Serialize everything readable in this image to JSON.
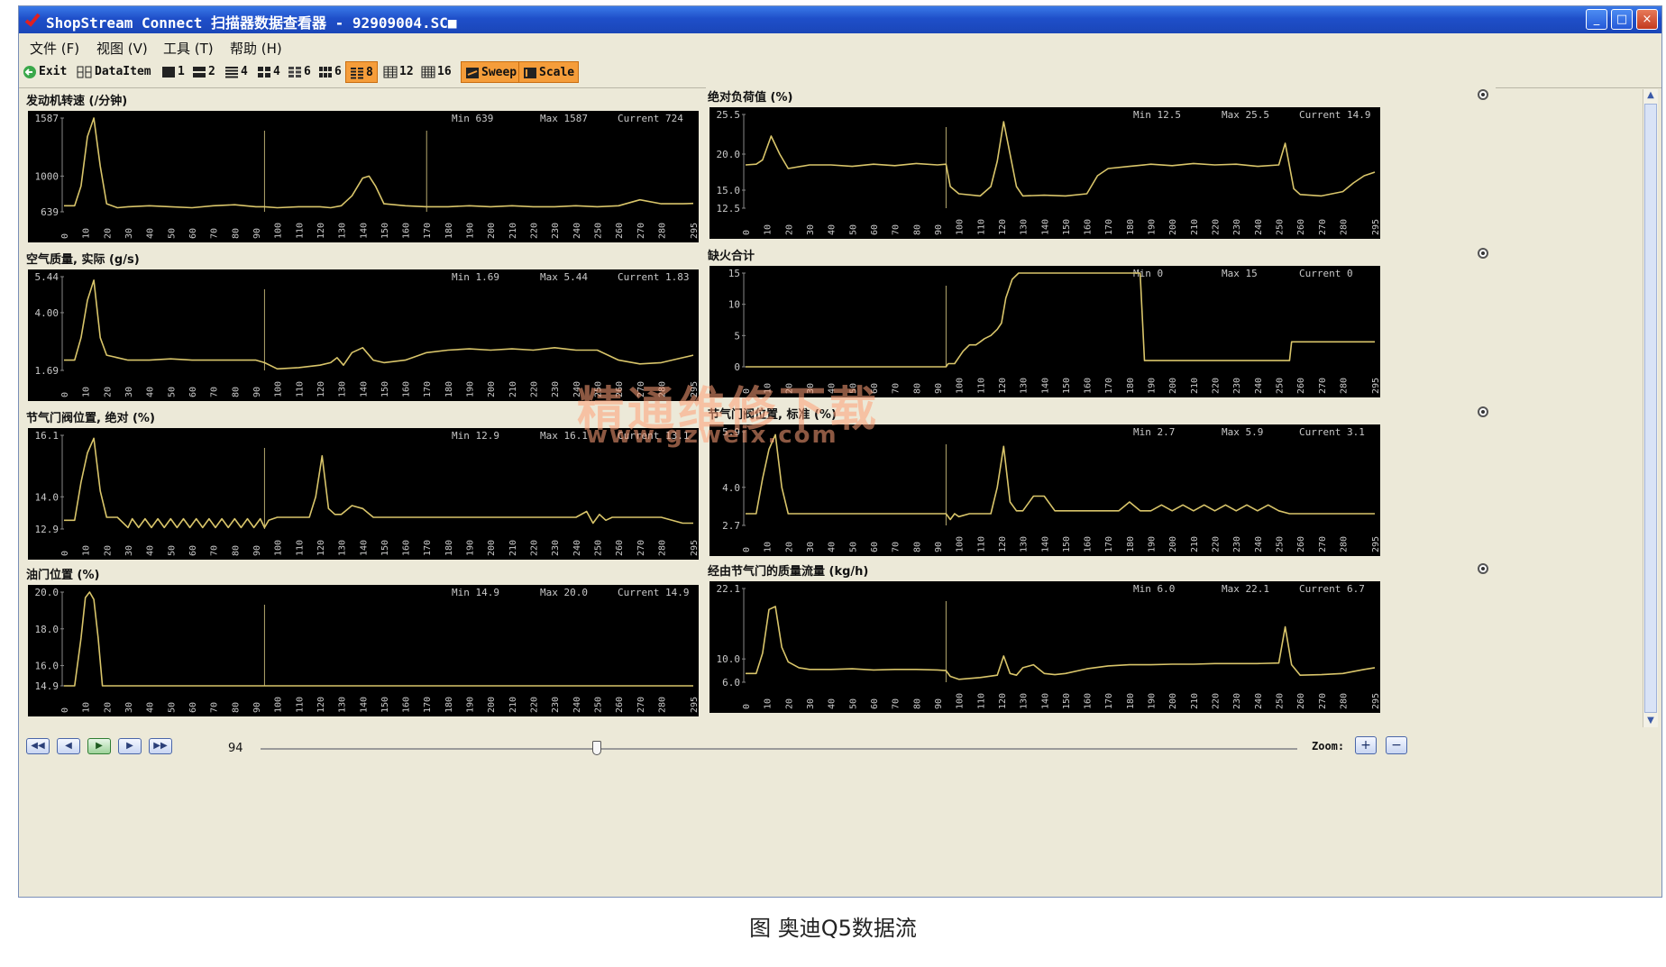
{
  "window": {
    "title": "ShopStream Connect 扫描器数据查看器 - 92909004.SC■",
    "controls": {
      "minimize": "_",
      "maximize": "□",
      "close": "×"
    }
  },
  "menu": [
    {
      "label": "文件 (F)"
    },
    {
      "label": "视图 (V)"
    },
    {
      "label": "工具 (T)"
    },
    {
      "label": "帮助 (H)"
    }
  ],
  "toolbar": {
    "exit": "Exit",
    "dataitem": "DataItem",
    "layouts": [
      "1",
      "2",
      "4",
      "4",
      "6",
      "6",
      "8",
      "12",
      "16"
    ],
    "active_layout_index": 6,
    "sweep": "Sweep",
    "scale": "Scale"
  },
  "chart_data": [
    {
      "type": "line",
      "title": "发动机转速 (/分钟)",
      "min_label": "Min",
      "max_label": "Max",
      "current_label": "Current",
      "min": "639",
      "max": "1587",
      "current": "724",
      "y_ticks": [
        "1587",
        "1000",
        "639"
      ],
      "y_tick_values": [
        1587,
        1000,
        639
      ],
      "ylim": [
        639,
        1587
      ],
      "x_ticks": [
        "0",
        "10",
        "20",
        "30",
        "40",
        "50",
        "60",
        "70",
        "80",
        "90",
        "100",
        "110",
        "120",
        "130",
        "140",
        "150",
        "160",
        "170",
        "180",
        "190",
        "200",
        "210",
        "220",
        "230",
        "240",
        "250",
        "260",
        "270",
        "280",
        "295"
      ],
      "xlim": [
        0,
        295
      ],
      "markers": [
        94,
        170
      ],
      "x": [
        0,
        5,
        8,
        11,
        14,
        17,
        20,
        25,
        30,
        40,
        50,
        60,
        70,
        80,
        90,
        94,
        100,
        110,
        120,
        125,
        130,
        135,
        140,
        143,
        146,
        150,
        160,
        170,
        180,
        190,
        200,
        210,
        220,
        230,
        240,
        250,
        260,
        270,
        280,
        290,
        295
      ],
      "y": [
        700,
        700,
        900,
        1400,
        1587,
        1100,
        720,
        680,
        690,
        700,
        690,
        680,
        700,
        710,
        690,
        690,
        680,
        690,
        690,
        680,
        700,
        800,
        980,
        1000,
        900,
        720,
        700,
        690,
        690,
        700,
        690,
        700,
        690,
        690,
        700,
        690,
        700,
        760,
        720,
        720,
        724
      ]
    },
    {
      "type": "line",
      "title": "绝对负荷值 (%)",
      "min_label": "Min",
      "max_label": "Max",
      "current_label": "Current",
      "min": "12.5",
      "max": "25.5",
      "current": "14.9",
      "y_ticks": [
        "25.5",
        "20.0",
        "15.0",
        "12.5"
      ],
      "y_tick_values": [
        25.5,
        20.0,
        15.0,
        12.5
      ],
      "ylim": [
        12.5,
        25.5
      ],
      "x_ticks": [
        "0",
        "10",
        "20",
        "30",
        "40",
        "50",
        "60",
        "70",
        "80",
        "90",
        "100",
        "110",
        "120",
        "130",
        "140",
        "150",
        "160",
        "170",
        "180",
        "190",
        "200",
        "210",
        "220",
        "230",
        "240",
        "250",
        "260",
        "270",
        "280",
        "295"
      ],
      "xlim": [
        0,
        295
      ],
      "markers": [
        94
      ],
      "x": [
        0,
        5,
        8,
        12,
        16,
        20,
        30,
        40,
        50,
        60,
        70,
        80,
        90,
        94,
        96,
        100,
        110,
        115,
        118,
        121,
        124,
        127,
        130,
        140,
        150,
        160,
        165,
        170,
        180,
        190,
        200,
        210,
        220,
        230,
        240,
        250,
        253,
        257,
        260,
        270,
        280,
        285,
        290,
        295
      ],
      "y": [
        18.5,
        18.6,
        19.2,
        22.5,
        20,
        18,
        18.5,
        18.5,
        18.3,
        18.6,
        18.4,
        18.7,
        18.5,
        18.6,
        15.5,
        14.5,
        14.2,
        15.5,
        19,
        24.5,
        20,
        15.5,
        14.2,
        14.3,
        14.2,
        14.5,
        17,
        18,
        18.3,
        18.6,
        18.4,
        18.7,
        18.5,
        18.6,
        18.3,
        18.5,
        21.5,
        15.2,
        14.4,
        14.2,
        14.8,
        16,
        17,
        17.5
      ]
    },
    {
      "type": "line",
      "title": "空气质量, 实际 (g/s)",
      "min_label": "Min",
      "max_label": "Max",
      "current_label": "Current",
      "min": "1.69",
      "max": "5.44",
      "current": "1.83",
      "y_ticks": [
        "5.44",
        "4.00",
        "1.69"
      ],
      "y_tick_values": [
        5.44,
        4.0,
        1.69
      ],
      "ylim": [
        1.69,
        5.44
      ],
      "x_ticks": [
        "0",
        "10",
        "20",
        "30",
        "40",
        "50",
        "60",
        "70",
        "80",
        "90",
        "100",
        "110",
        "120",
        "130",
        "140",
        "150",
        "160",
        "170",
        "180",
        "190",
        "200",
        "210",
        "220",
        "230",
        "240",
        "250",
        "260",
        "270",
        "280",
        "295"
      ],
      "xlim": [
        0,
        295
      ],
      "markers": [
        94
      ],
      "x": [
        0,
        5,
        8,
        11,
        14,
        17,
        20,
        30,
        40,
        50,
        60,
        70,
        80,
        90,
        94,
        100,
        110,
        120,
        125,
        128,
        131,
        135,
        140,
        145,
        150,
        160,
        170,
        180,
        190,
        200,
        210,
        220,
        230,
        240,
        250,
        260,
        270,
        280,
        290,
        295
      ],
      "y": [
        2.1,
        2.1,
        3,
        4.5,
        5.3,
        3,
        2.3,
        2.1,
        2.1,
        2.15,
        2.1,
        2.1,
        2.1,
        2.1,
        2.0,
        1.75,
        1.8,
        1.9,
        2.0,
        2.2,
        1.9,
        2.4,
        2.6,
        2.1,
        2.0,
        2.1,
        2.4,
        2.5,
        2.55,
        2.5,
        2.55,
        2.5,
        2.6,
        2.5,
        2.5,
        2.1,
        1.95,
        2.0,
        2.2,
        2.3
      ]
    },
    {
      "type": "line",
      "title": "缺火合计",
      "min_label": "Min",
      "max_label": "Max",
      "current_label": "Current",
      "min": "0",
      "max": "15",
      "current": "0",
      "y_ticks": [
        "15",
        "10",
        "5",
        "0"
      ],
      "y_tick_values": [
        15,
        10,
        5,
        0
      ],
      "ylim": [
        0,
        15
      ],
      "x_ticks": [
        "0",
        "10",
        "20",
        "30",
        "40",
        "50",
        "60",
        "70",
        "80",
        "90",
        "100",
        "110",
        "120",
        "130",
        "140",
        "150",
        "160",
        "170",
        "180",
        "190",
        "200",
        "210",
        "220",
        "230",
        "240",
        "250",
        "260",
        "270",
        "280",
        "295"
      ],
      "xlim": [
        0,
        295
      ],
      "markers": [
        94
      ],
      "x": [
        0,
        94,
        95,
        98,
        100,
        102,
        105,
        108,
        110,
        112,
        115,
        118,
        120,
        122,
        125,
        128,
        130,
        185,
        186,
        187,
        190,
        200,
        250,
        255,
        256,
        260,
        280,
        295
      ],
      "y": [
        0,
        0,
        0.5,
        0.5,
        1.5,
        2.5,
        3.5,
        3.5,
        4,
        4.5,
        5,
        6,
        7,
        11,
        14,
        15,
        15,
        15,
        8,
        1,
        1,
        1,
        1,
        1,
        4,
        4,
        4,
        4
      ]
    },
    {
      "type": "line",
      "title": "节气门阀位置, 绝对 (%)",
      "min_label": "Min",
      "max_label": "Max",
      "current_label": "Current",
      "min": "12.9",
      "max": "16.1",
      "current": "13.1",
      "y_ticks": [
        "16.1",
        "14.0",
        "12.9"
      ],
      "y_tick_values": [
        16.1,
        14.0,
        12.9
      ],
      "ylim": [
        12.9,
        16.1
      ],
      "x_ticks": [
        "0",
        "10",
        "20",
        "30",
        "40",
        "50",
        "60",
        "70",
        "80",
        "90",
        "100",
        "110",
        "120",
        "130",
        "140",
        "150",
        "160",
        "170",
        "180",
        "190",
        "200",
        "210",
        "220",
        "230",
        "240",
        "250",
        "260",
        "270",
        "280",
        "295"
      ],
      "xlim": [
        0,
        295
      ],
      "markers": [
        94
      ],
      "x": [
        0,
        5,
        8,
        11,
        14,
        17,
        20,
        25,
        30,
        32,
        35,
        38,
        41,
        44,
        47,
        50,
        53,
        56,
        59,
        62,
        65,
        68,
        71,
        74,
        77,
        80,
        83,
        86,
        89,
        92,
        94,
        96,
        100,
        110,
        115,
        118,
        121,
        124,
        127,
        130,
        135,
        140,
        145,
        150,
        160,
        170,
        180,
        190,
        200,
        210,
        220,
        230,
        240,
        245,
        248,
        251,
        254,
        257,
        260,
        270,
        280,
        290,
        295
      ],
      "y": [
        13.2,
        13.2,
        14.5,
        15.5,
        16.0,
        14.2,
        13.3,
        13.3,
        12.95,
        13.25,
        12.95,
        13.25,
        12.95,
        13.25,
        12.95,
        13.25,
        12.95,
        13.25,
        12.95,
        13.25,
        12.95,
        13.25,
        12.95,
        13.25,
        12.95,
        13.25,
        12.95,
        13.25,
        12.95,
        13.25,
        12.95,
        13.2,
        13.3,
        13.3,
        13.3,
        14.0,
        15.4,
        13.6,
        13.4,
        13.4,
        13.7,
        13.6,
        13.3,
        13.3,
        13.3,
        13.3,
        13.3,
        13.3,
        13.3,
        13.3,
        13.3,
        13.3,
        13.3,
        13.5,
        13.1,
        13.4,
        13.2,
        13.3,
        13.3,
        13.3,
        13.3,
        13.1,
        13.1
      ]
    },
    {
      "type": "line",
      "title": "节气门阀位置, 标准 (%)",
      "min_label": "Min",
      "max_label": "Max",
      "current_label": "Current",
      "min": "2.7",
      "max": "5.9",
      "current": "3.1",
      "y_ticks": [
        "5.9",
        "4.0",
        "2.7"
      ],
      "y_tick_values": [
        5.9,
        4.0,
        2.7
      ],
      "ylim": [
        2.7,
        5.9
      ],
      "x_ticks": [
        "0",
        "10",
        "20",
        "30",
        "40",
        "50",
        "60",
        "70",
        "80",
        "90",
        "100",
        "110",
        "120",
        "130",
        "140",
        "150",
        "160",
        "170",
        "180",
        "190",
        "200",
        "210",
        "220",
        "230",
        "240",
        "250",
        "260",
        "270",
        "280",
        "295"
      ],
      "xlim": [
        0,
        295
      ],
      "markers": [
        94
      ],
      "x": [
        0,
        5,
        8,
        11,
        14,
        17,
        20,
        30,
        40,
        50,
        60,
        70,
        80,
        90,
        94,
        96,
        98,
        100,
        105,
        110,
        115,
        118,
        121,
        124,
        127,
        130,
        135,
        140,
        145,
        150,
        160,
        170,
        175,
        180,
        185,
        190,
        195,
        200,
        205,
        210,
        215,
        220,
        225,
        230,
        235,
        240,
        245,
        250,
        255,
        260,
        270,
        280,
        290,
        295
      ],
      "y": [
        3.1,
        3.1,
        4.3,
        5.3,
        5.8,
        4.0,
        3.1,
        3.1,
        3.1,
        3.1,
        3.1,
        3.1,
        3.1,
        3.1,
        3.1,
        2.9,
        3.1,
        3.0,
        3.1,
        3.1,
        3.1,
        4.0,
        5.4,
        3.5,
        3.2,
        3.2,
        3.7,
        3.7,
        3.2,
        3.2,
        3.2,
        3.2,
        3.2,
        3.5,
        3.2,
        3.2,
        3.4,
        3.2,
        3.4,
        3.2,
        3.4,
        3.2,
        3.4,
        3.2,
        3.4,
        3.2,
        3.4,
        3.2,
        3.1,
        3.1,
        3.1,
        3.1,
        3.1,
        3.1
      ]
    },
    {
      "type": "line",
      "title": "油门位置 (%)",
      "min_label": "Min",
      "max_label": "Max",
      "current_label": "Current",
      "min": "14.9",
      "max": "20.0",
      "current": "14.9",
      "y_ticks": [
        "20.0",
        "18.0",
        "16.0",
        "14.9"
      ],
      "y_tick_values": [
        20.0,
        18.0,
        16.0,
        14.9
      ],
      "ylim": [
        14.9,
        20.0
      ],
      "x_ticks": [
        "0",
        "10",
        "20",
        "30",
        "40",
        "50",
        "60",
        "70",
        "80",
        "90",
        "100",
        "110",
        "120",
        "130",
        "140",
        "150",
        "160",
        "170",
        "180",
        "190",
        "200",
        "210",
        "220",
        "230",
        "240",
        "250",
        "260",
        "270",
        "280",
        "295"
      ],
      "xlim": [
        0,
        295
      ],
      "markers": [
        94
      ],
      "x": [
        0,
        5,
        8,
        10,
        12,
        14,
        16,
        18,
        30,
        60,
        94,
        150,
        200,
        250,
        295
      ],
      "y": [
        14.9,
        14.9,
        17.5,
        19.7,
        20.0,
        19.6,
        17.5,
        14.9,
        14.9,
        14.9,
        14.9,
        14.9,
        14.9,
        14.9,
        14.9
      ]
    },
    {
      "type": "line",
      "title": "经由节气门的质量流量 (kg/h)",
      "min_label": "Min",
      "max_label": "Max",
      "current_label": "Current",
      "min": "6.0",
      "max": "22.1",
      "current": "6.7",
      "y_ticks": [
        "22.1",
        "10.0",
        "6.0"
      ],
      "y_tick_values": [
        22.1,
        10.0,
        6.0
      ],
      "ylim": [
        6.0,
        22.1
      ],
      "x_ticks": [
        "0",
        "10",
        "20",
        "30",
        "40",
        "50",
        "60",
        "70",
        "80",
        "90",
        "100",
        "110",
        "120",
        "130",
        "140",
        "150",
        "160",
        "170",
        "180",
        "190",
        "200",
        "210",
        "220",
        "230",
        "240",
        "250",
        "260",
        "270",
        "280",
        "295"
      ],
      "xlim": [
        0,
        295
      ],
      "markers": [
        94
      ],
      "x": [
        0,
        5,
        8,
        11,
        14,
        17,
        20,
        25,
        30,
        40,
        50,
        60,
        70,
        80,
        90,
        94,
        96,
        100,
        110,
        118,
        121,
        124,
        127,
        130,
        135,
        140,
        145,
        150,
        160,
        170,
        180,
        190,
        200,
        210,
        220,
        230,
        240,
        250,
        253,
        256,
        260,
        270,
        280,
        290,
        295
      ],
      "y": [
        7.5,
        7.5,
        11,
        18.5,
        19,
        12,
        9.5,
        8.5,
        8.2,
        8.2,
        8.3,
        8.1,
        8.2,
        8.2,
        8.1,
        8.0,
        7.0,
        6.5,
        6.8,
        7.2,
        10.5,
        7.5,
        7.2,
        8.5,
        9.0,
        7.5,
        7.3,
        7.5,
        8.3,
        8.8,
        9.0,
        9.0,
        9.1,
        9.1,
        9.2,
        9.2,
        9.2,
        9.3,
        15.5,
        9.0,
        7.2,
        7.3,
        7.5,
        8.2,
        8.5
      ]
    }
  ],
  "playback": {
    "frame": "94",
    "zoom_label": "Zoom:",
    "zoom_in": "+",
    "zoom_out": "−",
    "slider_fraction": 0.32
  },
  "caption": "图 奥迪Q5数据流",
  "watermark": {
    "line1": "精通维修下载",
    "line2": "www.gzweix.com"
  },
  "colors": {
    "chart_bg": "#000000",
    "trace": "#d9c56a",
    "marker": "#e3d48a",
    "axis_text": "#c8c8c8"
  }
}
